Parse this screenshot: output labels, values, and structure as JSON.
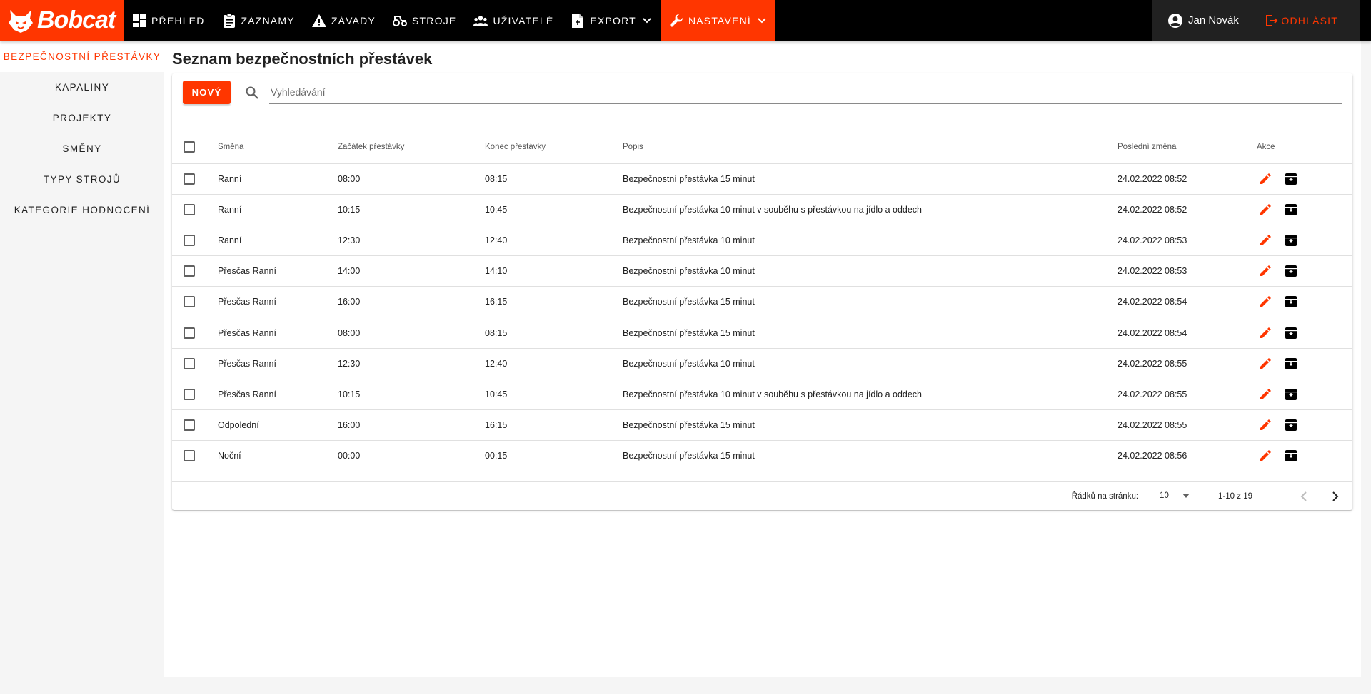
{
  "brand": {
    "name": "Bobcat",
    "accent": "#ff3600"
  },
  "nav": {
    "items": [
      {
        "label": "PŘEHLED",
        "icon": "dashboard-icon"
      },
      {
        "label": "ZÁZNAMY",
        "icon": "clipboard-icon"
      },
      {
        "label": "ZÁVADY",
        "icon": "warning-icon"
      },
      {
        "label": "STROJE",
        "icon": "tractor-icon"
      },
      {
        "label": "UŽIVATELÉ",
        "icon": "users-icon"
      },
      {
        "label": "EXPORT",
        "icon": "file-icon"
      },
      {
        "label": "NASTAVENÍ",
        "icon": "wrench-icon"
      }
    ],
    "active": "NASTAVENÍ"
  },
  "user": {
    "name": "Jan Novák",
    "logout_label": "ODHLÁSIT"
  },
  "sidebar": {
    "items": [
      {
        "label": "BEZPEČNOSTNÍ PŘESTÁVKY"
      },
      {
        "label": "KAPALINY"
      },
      {
        "label": "PROJEKTY"
      },
      {
        "label": "SMĚNY"
      },
      {
        "label": "TYPY STROJŮ"
      },
      {
        "label": "KATEGORIE HODNOCENÍ"
      }
    ],
    "active": "BEZPEČNOSTNÍ PŘESTÁVKY"
  },
  "page": {
    "title": "Seznam bezpečnostních přestávek",
    "new_button": "NOVÝ",
    "search_placeholder": "Vyhledávání"
  },
  "table": {
    "columns": {
      "shift": "Směna",
      "start": "Začátek přestávky",
      "end": "Konec přestávky",
      "description": "Popis",
      "last_change": "Poslední změna",
      "actions": "Akce"
    },
    "rows": [
      {
        "shift": "Ranní",
        "start": "08:00",
        "end": "08:15",
        "description": "Bezpečnostní přestávka 15 minut",
        "last_change": "24.02.2022 08:52"
      },
      {
        "shift": "Ranní",
        "start": "10:15",
        "end": "10:45",
        "description": "Bezpečnostní přestávka 10 minut v souběhu s přestávkou na jídlo a oddech",
        "last_change": "24.02.2022 08:52"
      },
      {
        "shift": "Ranní",
        "start": "12:30",
        "end": "12:40",
        "description": "Bezpečnostní přestávka 10 minut",
        "last_change": "24.02.2022 08:53"
      },
      {
        "shift": "Přesčas Ranní",
        "start": "14:00",
        "end": "14:10",
        "description": "Bezpečnostní přestávka 10 minut",
        "last_change": "24.02.2022 08:53"
      },
      {
        "shift": "Přesčas Ranní",
        "start": "16:00",
        "end": "16:15",
        "description": "Bezpečnostní přestávka 15 minut",
        "last_change": "24.02.2022 08:54"
      },
      {
        "shift": "Přesčas Ranní",
        "start": "08:00",
        "end": "08:15",
        "description": "Bezpečnostní přestávka 15 minut",
        "last_change": "24.02.2022 08:54"
      },
      {
        "shift": "Přesčas Ranní",
        "start": "12:30",
        "end": "12:40",
        "description": "Bezpečnostní přestávka 10 minut",
        "last_change": "24.02.2022 08:55"
      },
      {
        "shift": "Přesčas Ranní",
        "start": "10:15",
        "end": "10:45",
        "description": "Bezpečnostní přestávka 10 minut v souběhu s přestávkou na jídlo a oddech",
        "last_change": "24.02.2022 08:55"
      },
      {
        "shift": "Odpolední",
        "start": "16:00",
        "end": "16:15",
        "description": "Bezpečnostní přestávka 15 minut",
        "last_change": "24.02.2022 08:55"
      },
      {
        "shift": "Noční",
        "start": "00:00",
        "end": "00:15",
        "description": "Bezpečnostní přestávka 15 minut",
        "last_change": "24.02.2022 08:56"
      }
    ]
  },
  "pagination": {
    "rows_per_page_label": "Řádků na stránku:",
    "rows_per_page": "10",
    "range": "1-10 z 19"
  }
}
